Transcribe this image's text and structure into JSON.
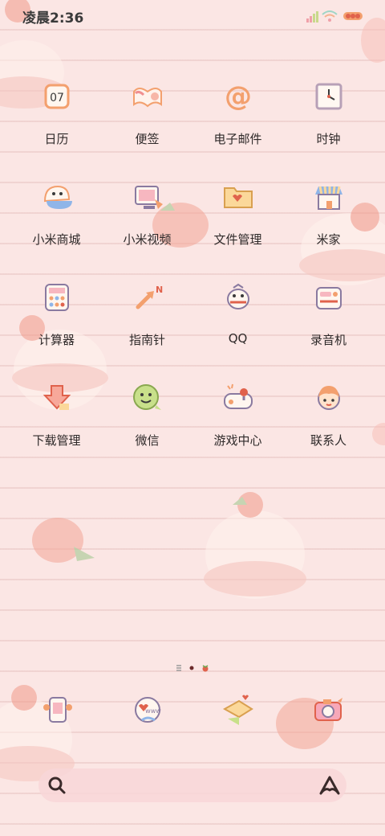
{
  "status_bar": {
    "time": "凌晨2:36"
  },
  "apps": [
    {
      "label": "日历",
      "date": "07",
      "icon": "calendar-icon"
    },
    {
      "label": "便签",
      "icon": "notes-icon"
    },
    {
      "label": "电子邮件",
      "at": "@",
      "icon": "email-icon"
    },
    {
      "label": "时钟",
      "icon": "clock-icon"
    },
    {
      "label": "小米商城",
      "icon": "mi-store-icon"
    },
    {
      "label": "小米视频",
      "icon": "mi-video-icon"
    },
    {
      "label": "文件管理",
      "icon": "file-manager-icon"
    },
    {
      "label": "米家",
      "icon": "mi-home-icon"
    },
    {
      "label": "计算器",
      "icon": "calculator-icon"
    },
    {
      "label": "指南针",
      "icon": "compass-icon"
    },
    {
      "label": "QQ",
      "icon": "qq-icon"
    },
    {
      "label": "录音机",
      "icon": "recorder-icon"
    },
    {
      "label": "下载管理",
      "icon": "download-manager-icon"
    },
    {
      "label": "微信",
      "icon": "wechat-icon"
    },
    {
      "label": "游戏中心",
      "icon": "game-center-icon"
    },
    {
      "label": "联系人",
      "icon": "contacts-icon"
    }
  ],
  "dock": [
    {
      "icon": "phone-icon"
    },
    {
      "icon": "browser-icon",
      "text": "www"
    },
    {
      "icon": "messages-icon"
    },
    {
      "icon": "camera-icon"
    }
  ],
  "search": {
    "icon": "search-icon",
    "assistant_icon": "assistant-icon"
  },
  "colors": {
    "background": "#fbe6e4",
    "accent": "#f3a08c",
    "line": "#e8c4c2"
  }
}
